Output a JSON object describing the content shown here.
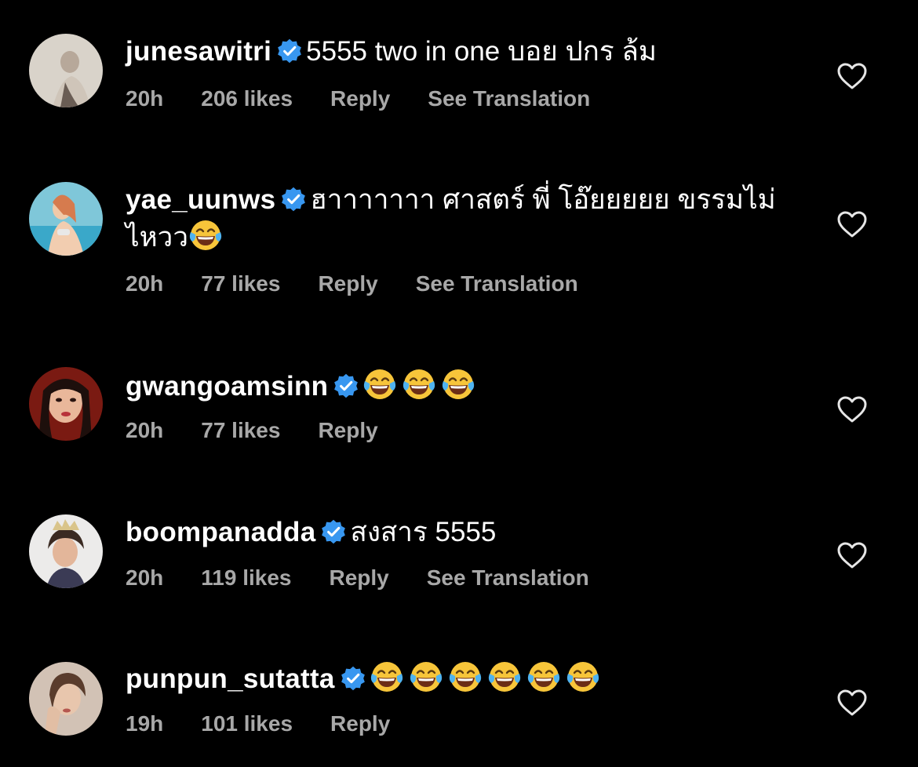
{
  "comments": [
    {
      "username": "junesawitri",
      "text": "5555 two in one บอย ปกร ล้ม",
      "emoji_count": 0,
      "time": "20h",
      "likes": "206 likes",
      "reply": "Reply",
      "translate": "See Translation"
    },
    {
      "username": "yae_uunws",
      "text": "ฮาาาาาาา ศาสตร์ พี่ โอ๊ยยยยย ขรรมไม่ไหวว",
      "emoji_count": 1,
      "time": "20h",
      "likes": "77 likes",
      "reply": "Reply",
      "translate": "See Translation"
    },
    {
      "username": "gwangoamsinn",
      "text": "",
      "emoji_count": 3,
      "time": "20h",
      "likes": "77 likes",
      "reply": "Reply",
      "translate": ""
    },
    {
      "username": "boompanadda",
      "text": "สงสาร 5555",
      "emoji_count": 0,
      "time": "20h",
      "likes": "119 likes",
      "reply": "Reply",
      "translate": "See Translation"
    },
    {
      "username": "punpun_sutatta",
      "text": "",
      "emoji_count": 6,
      "time": "19h",
      "likes": "101 likes",
      "reply": "Reply",
      "translate": ""
    }
  ],
  "icons": {
    "verified": "verified-badge-icon",
    "emoji": "face-with-tears-of-joy-emoji",
    "like": "heart-outline-icon"
  },
  "colors": {
    "background": "#000000",
    "username": "#ffffff",
    "meta": "#a8a8a8",
    "verified": "#3897f0"
  }
}
